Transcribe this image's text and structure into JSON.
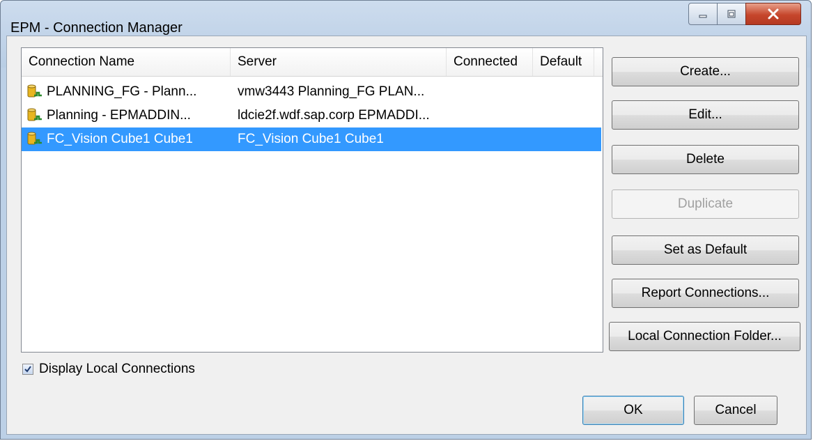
{
  "window": {
    "title": "EPM - Connection Manager"
  },
  "list": {
    "columns": [
      "Connection Name",
      "Server",
      "Connected",
      "Default"
    ],
    "rows": [
      {
        "name": "PLANNING_FG - Plann...",
        "server": "vmw3443 Planning_FG PLAN...",
        "connected": "",
        "default": "",
        "selected": false
      },
      {
        "name": "Planning - EPMADDIN...",
        "server": "ldcie2f.wdf.sap.corp EPMADDI...",
        "connected": "",
        "default": "",
        "selected": false
      },
      {
        "name": "FC_Vision Cube1 Cube1",
        "server": "FC_Vision Cube1 Cube1",
        "connected": "",
        "default": "",
        "selected": true
      }
    ]
  },
  "buttons": {
    "create": "Create...",
    "edit": "Edit...",
    "delete": "Delete",
    "duplicate": "Duplicate",
    "set_default": "Set as Default",
    "report_connections": "Report Connections...",
    "local_folder": "Local Connection Folder...",
    "ok": "OK",
    "cancel": "Cancel"
  },
  "display_local": {
    "label": "Display Local Connections",
    "checked": true
  },
  "colors": {
    "selection": "#3399ff",
    "title_bar": "#bcd0e6",
    "close_button": "#c6462c"
  }
}
